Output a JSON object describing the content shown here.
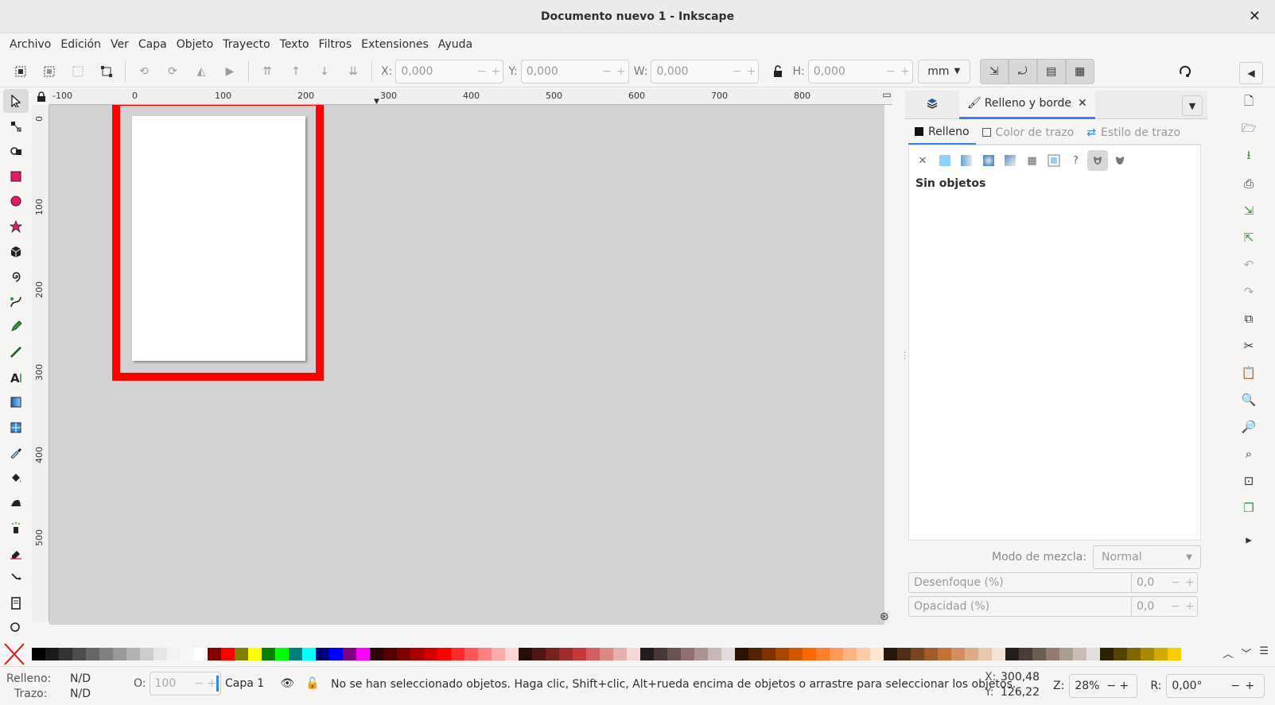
{
  "window": {
    "title": "Documento nuevo 1 - Inkscape",
    "close": "✕"
  },
  "menu": [
    "Archivo",
    "Edición",
    "Ver",
    "Capa",
    "Objeto",
    "Trayecto",
    "Texto",
    "Filtros",
    "Extensiones",
    "Ayuda"
  ],
  "toolbar": {
    "x_label": "X:",
    "x_value": "0,000",
    "y_label": "Y:",
    "y_value": "0,000",
    "w_label": "W:",
    "w_value": "0,000",
    "h_label": "H:",
    "h_value": "0,000",
    "unit": "mm"
  },
  "ruler": {
    "h_ticks": [
      "-100",
      "0",
      "100",
      "200",
      "300",
      "400",
      "500",
      "600",
      "700",
      "800"
    ],
    "v_ticks": [
      "0",
      "100",
      "200",
      "300",
      "400",
      "500"
    ]
  },
  "dock": {
    "tab_label": "Relleno y borde",
    "subtabs": [
      "Relleno",
      "Color de trazo",
      "Estilo de trazo"
    ],
    "empty_message": "Sin objetos",
    "blend_label": "Modo de mezcla:",
    "blend_value": "Normal",
    "blur_label": "Desenfoque (%)",
    "blur_value": "0,0",
    "opacity_label": "Opacidad (%)",
    "opacity_value": "0,0"
  },
  "palette": {
    "colors": [
      "#000000",
      "#1a1a1a",
      "#333333",
      "#4d4d4d",
      "#666666",
      "#808080",
      "#999999",
      "#b3b3b3",
      "#cccccc",
      "#e6e6e6",
      "#f2f2f2",
      "#f8f8f8",
      "#ffffff",
      "#800000",
      "#ff0000",
      "#808000",
      "#ffff00",
      "#008000",
      "#00ff00",
      "#008080",
      "#00ffff",
      "#000080",
      "#0000ff",
      "#800080",
      "#ff00ff",
      "#2b0000",
      "#550000",
      "#800000",
      "#aa0000",
      "#d40000",
      "#ff0000",
      "#ff2a2a",
      "#ff5555",
      "#ff8080",
      "#ffaaaa",
      "#ffd5d5",
      "#280b0b",
      "#501616",
      "#782121",
      "#a02c2c",
      "#c83737",
      "#d35f5f",
      "#de8787",
      "#e9afaf",
      "#f4d7d7",
      "#241c1c",
      "#483737",
      "#6c5353",
      "#916f6f",
      "#ac9393",
      "#c8b7b7",
      "#e3dbdb",
      "#2b1100",
      "#552200",
      "#803300",
      "#aa4400",
      "#d45500",
      "#ff6600",
      "#ff7f2a",
      "#ff9955",
      "#ffb380",
      "#ffccaa",
      "#ffe6d5",
      "#28170b",
      "#502d16",
      "#784421",
      "#a05a2c",
      "#c87137",
      "#d38d5f",
      "#deaa87",
      "#e9c6af",
      "#f4e3d7",
      "#241f1c",
      "#483e37",
      "#6c5d53",
      "#917c6f",
      "#ac9d93",
      "#c8beb7",
      "#e3dedb",
      "#2b2200",
      "#554400",
      "#806600",
      "#aa8800",
      "#d4aa00",
      "#ffcc00"
    ]
  },
  "status": {
    "fill_label": "Relleno:",
    "fill_value": "N/D",
    "stroke_label": "Trazo:",
    "stroke_value": "N/D",
    "opacity_label": "O:",
    "opacity_value": "100",
    "layer": "Capa 1",
    "message": "No se han seleccionado objetos. Haga clic, Shift+clic, Alt+rueda encima de objetos o arrastre para seleccionar los objetos.",
    "x_label": "X:",
    "x_value": "300,48",
    "y_label": "Y:",
    "y_value": "126,22",
    "zoom_label": "Z:",
    "zoom_value": "28%",
    "rot_label": "R:",
    "rot_value": "0,00°"
  }
}
